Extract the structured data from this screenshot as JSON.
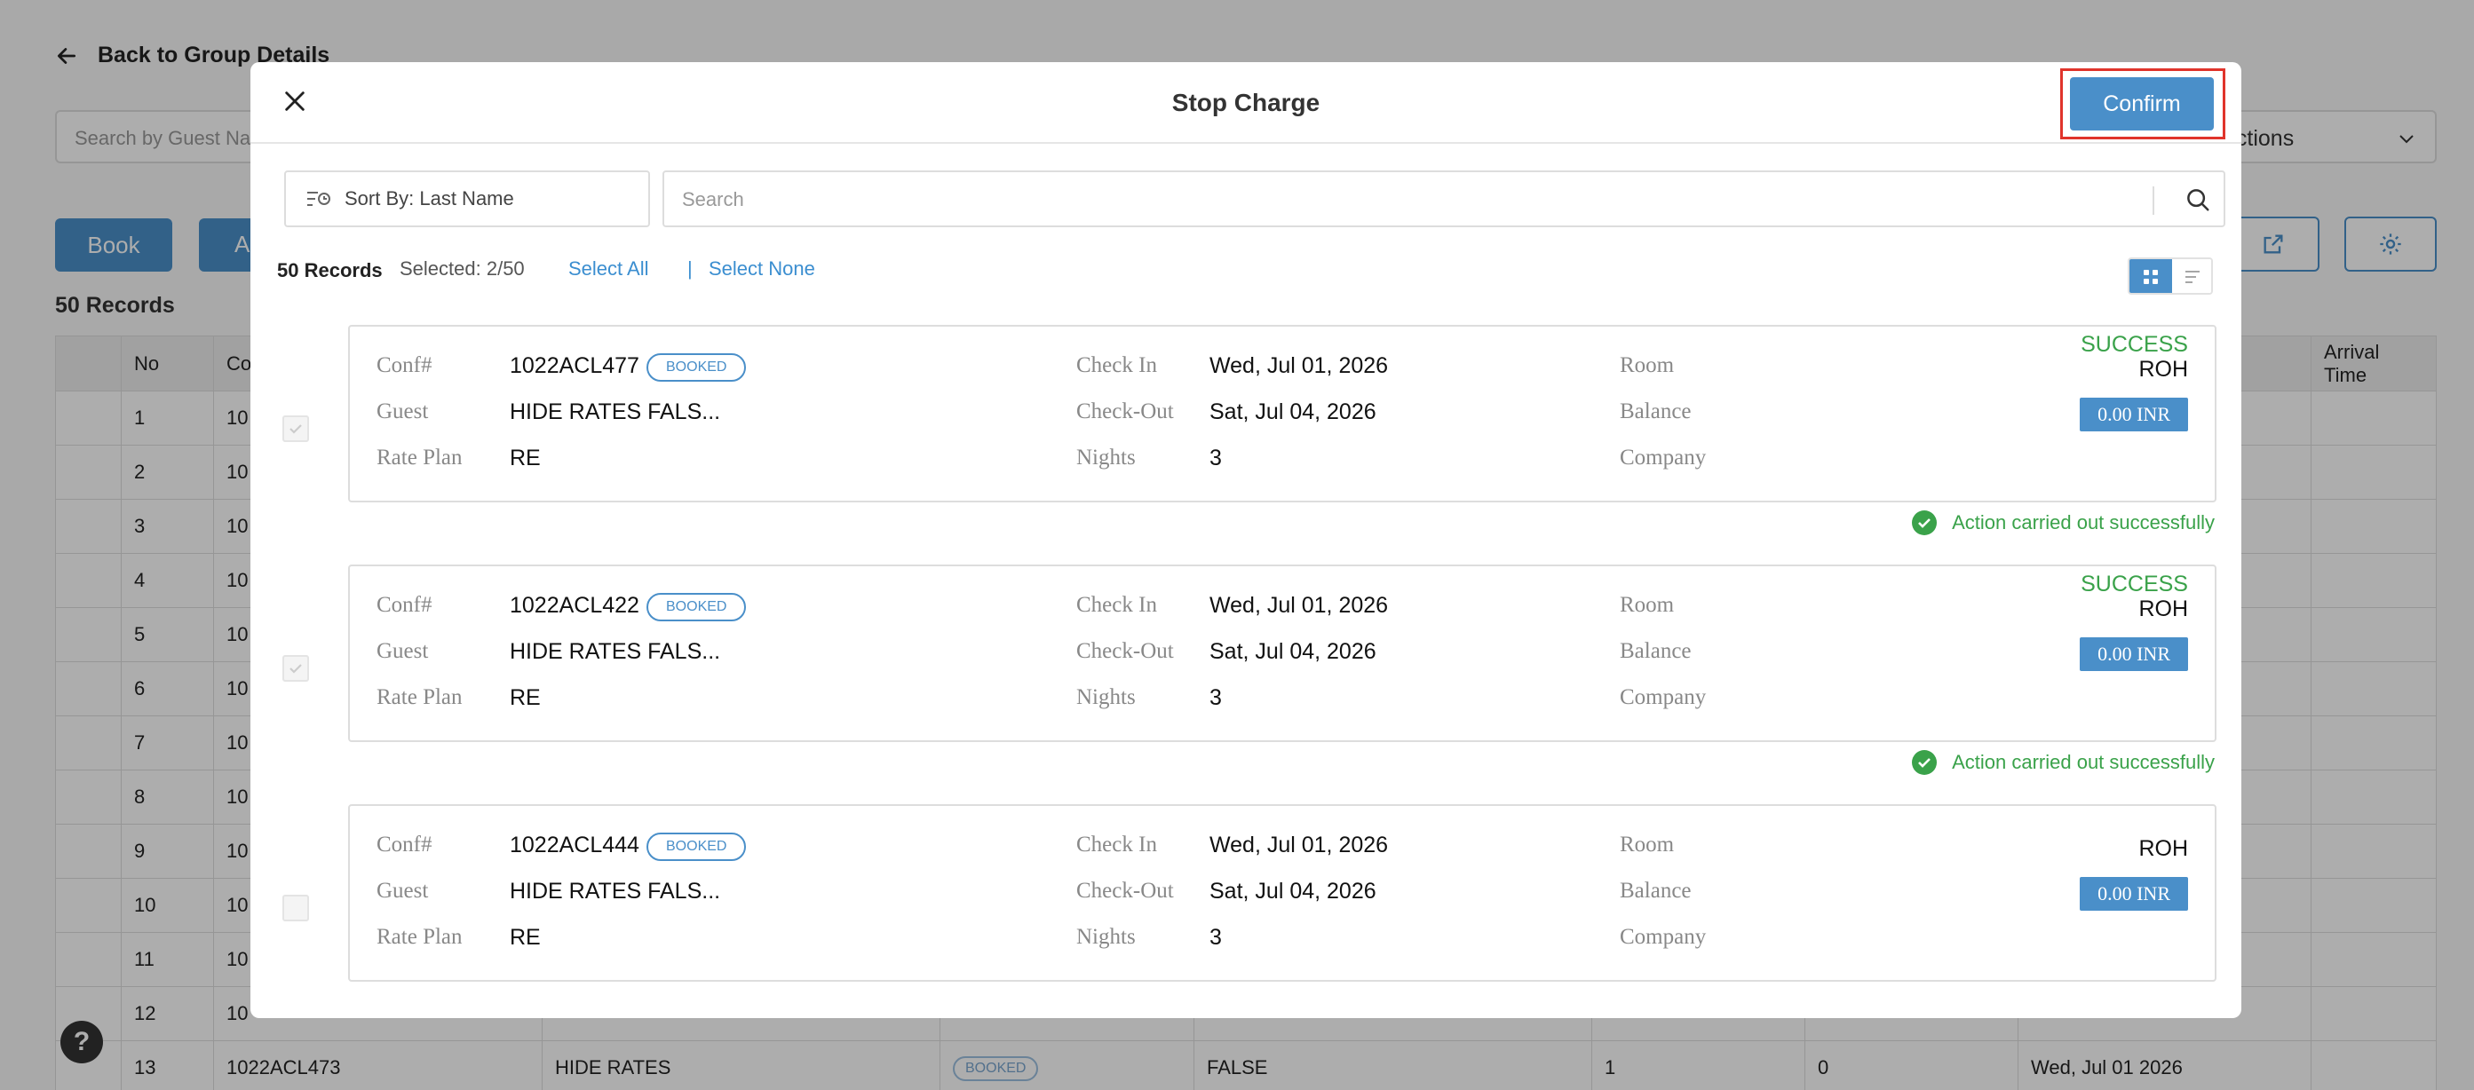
{
  "background": {
    "back_label": "Back to Group Details",
    "search_placeholder": "Search by Guest Nam",
    "actions_label": "ng List Actions",
    "book_button": "Book",
    "second_button": "A",
    "records_label": "50 Records",
    "table_headers": [
      "No",
      "Co",
      "",
      "",
      "",
      "",
      "",
      "",
      "Arrival Time"
    ],
    "rows": [
      {
        "no": "1",
        "conf": "10"
      },
      {
        "no": "2",
        "conf": "10"
      },
      {
        "no": "3",
        "conf": "10"
      },
      {
        "no": "4",
        "conf": "10"
      },
      {
        "no": "5",
        "conf": "10"
      },
      {
        "no": "6",
        "conf": "10"
      },
      {
        "no": "7",
        "conf": "10"
      },
      {
        "no": "8",
        "conf": "10"
      },
      {
        "no": "9",
        "conf": "10"
      },
      {
        "no": "10",
        "conf": "10"
      },
      {
        "no": "11",
        "conf": "10"
      },
      {
        "no": "12",
        "conf": "10"
      },
      {
        "no": "13",
        "conf": "1022ACL473",
        "guest": "HIDE RATES",
        "status": "BOOKED",
        "flag": "FALSE",
        "nights": "1",
        "col7": "0",
        "date": "Wed, Jul 01 2026"
      }
    ],
    "help_label": "?"
  },
  "modal": {
    "title": "Stop Charge",
    "confirm_label": "Confirm",
    "sort_label": "Sort By: Last Name",
    "search_placeholder": "Search",
    "records_count": "50 Records",
    "selected_count": "Selected: 2/50",
    "select_all": "Select All",
    "separator": "|",
    "select_none": "Select None",
    "labels": {
      "conf": "Conf#",
      "guest": "Guest",
      "rate_plan": "Rate Plan",
      "check_in": "Check In",
      "check_out": "Check-Out",
      "nights": "Nights",
      "room": "Room",
      "balance": "Balance",
      "company": "Company"
    },
    "records": [
      {
        "conf": "1022ACL477",
        "badge": "BOOKED",
        "guest": "HIDE RATES FALS...",
        "rate_plan": "RE",
        "check_in": "Wed, Jul 01, 2026",
        "check_out": "Sat, Jul 04, 2026",
        "nights": "3",
        "room": "ROH",
        "balance": "0.00 INR",
        "company": "",
        "status": "SUCCESS",
        "result": "Action carried out successfully",
        "checked": true
      },
      {
        "conf": "1022ACL422",
        "badge": "BOOKED",
        "guest": "HIDE RATES FALS...",
        "rate_plan": "RE",
        "check_in": "Wed, Jul 01, 2026",
        "check_out": "Sat, Jul 04, 2026",
        "nights": "3",
        "room": "ROH",
        "balance": "0.00 INR",
        "company": "",
        "status": "SUCCESS",
        "result": "Action carried out successfully",
        "checked": true
      },
      {
        "conf": "1022ACL444",
        "badge": "BOOKED",
        "guest": "HIDE RATES FALS...",
        "rate_plan": "RE",
        "check_in": "Wed, Jul 01, 2026",
        "check_out": "Sat, Jul 04, 2026",
        "nights": "3",
        "room": "ROH",
        "balance": "0.00 INR",
        "company": "",
        "status": "",
        "result": "",
        "checked": false
      }
    ]
  },
  "colors": {
    "accent": "#4a8fc9",
    "success": "#3aa24a",
    "highlight": "#e0342b"
  },
  "icons": [
    "back-arrow-icon",
    "chevron-down-icon",
    "external-link-icon",
    "gear-icon",
    "close-icon",
    "sort-icon",
    "search-icon",
    "grid-view-icon",
    "list-view-icon",
    "check-icon",
    "success-check-icon",
    "help-icon"
  ]
}
